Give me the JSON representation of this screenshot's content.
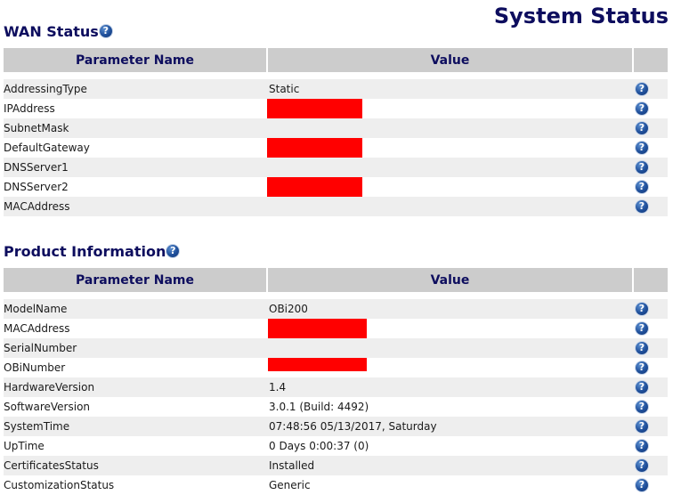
{
  "page_title": "System Status",
  "wan": {
    "title": "WAN Status",
    "headers": {
      "name": "Parameter Name",
      "value": "Value"
    },
    "rows": [
      {
        "name": "AddressingType",
        "value": "Static"
      },
      {
        "name": "IPAddress",
        "value": ""
      },
      {
        "name": "SubnetMask",
        "value": ""
      },
      {
        "name": "DefaultGateway",
        "value": ""
      },
      {
        "name": "DNSServer1",
        "value": ""
      },
      {
        "name": "DNSServer2",
        "value": ""
      },
      {
        "name": "MACAddress",
        "value": ""
      }
    ]
  },
  "product": {
    "title": "Product Information",
    "headers": {
      "name": "Parameter Name",
      "value": "Value"
    },
    "rows": [
      {
        "name": "ModelName",
        "value": "OBi200"
      },
      {
        "name": "MACAddress",
        "value": ""
      },
      {
        "name": "SerialNumber",
        "value": ""
      },
      {
        "name": "OBiNumber",
        "value": ""
      },
      {
        "name": "HardwareVersion",
        "value": "1.4"
      },
      {
        "name": "SoftwareVersion",
        "value": "3.0.1 (Build: 4492)"
      },
      {
        "name": "SystemTime",
        "value": "07:48:56 05/13/2017, Saturday"
      },
      {
        "name": "UpTime",
        "value": "0 Days 0:00:37 (0)"
      },
      {
        "name": "CertificatesStatus",
        "value": "Installed"
      },
      {
        "name": "CustomizationStatus",
        "value": "Generic"
      }
    ]
  },
  "help_glyph": "?",
  "colors": {
    "title": "#0d0d5e",
    "header_bg": "#cccccc",
    "alt_row": "#eeeeee",
    "redaction": "#ff0000"
  }
}
